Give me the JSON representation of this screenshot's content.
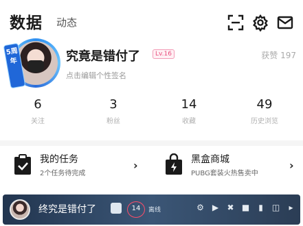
{
  "header": {
    "tab_data": "数据",
    "tab_feed": "动态",
    "icons": [
      "scan-icon",
      "gear-icon",
      "mail-icon"
    ]
  },
  "profile": {
    "anniversary_badge": "5周年",
    "name": "究竟是错付了",
    "level": "Lv.16",
    "likes": "获赞 197",
    "signature": "点击编辑个性签名"
  },
  "stats": [
    {
      "value": "6",
      "label": "关注"
    },
    {
      "value": "3",
      "label": "粉丝"
    },
    {
      "value": "14",
      "label": "收藏"
    },
    {
      "value": "49",
      "label": "历史浏览"
    }
  ],
  "cards": {
    "tasks": {
      "title": "我的任务",
      "subtitle": "2个任务待完成"
    },
    "shop": {
      "title": "黑盒商城",
      "subtitle": "PUBG套装火热售卖中"
    }
  },
  "bottom_bar": {
    "name": "终究是错付了",
    "count": "14",
    "tag": "离线",
    "platforms": [
      "steam-icon",
      "playstation-icon",
      "xbox-icon",
      "epic-icon",
      "mobile-icon",
      "switch-icon",
      "more-icon"
    ]
  },
  "colors": {
    "level_pink": "#e84c7d",
    "bar_bg": "#2b3d55",
    "count_ring": "#ff4d6a"
  }
}
